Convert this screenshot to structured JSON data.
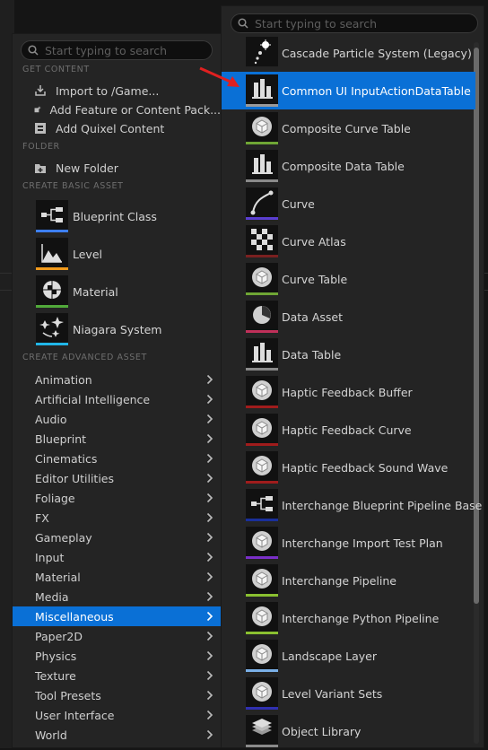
{
  "left_menu": {
    "search_placeholder": "Start typing to search",
    "sections": {
      "get_content": "GET CONTENT",
      "folder": "FOLDER",
      "basic": "CREATE BASIC ASSET",
      "advanced": "CREATE ADVANCED ASSET"
    },
    "get_content_items": [
      {
        "label": "Import to /Game...",
        "icon": "import-icon"
      },
      {
        "label": "Add Feature or Content Pack...",
        "icon": "content-pack-icon"
      },
      {
        "label": "Add Quixel Content",
        "icon": "quixel-icon"
      }
    ],
    "folder_items": [
      {
        "label": "New Folder",
        "icon": "new-folder-icon"
      }
    ],
    "basic_assets": [
      {
        "label": "Blueprint Class",
        "icon": "blueprint-class-icon",
        "color": "#3d7ff2"
      },
      {
        "label": "Level",
        "icon": "level-icon",
        "color": "#f19a1c"
      },
      {
        "label": "Material",
        "icon": "material-icon",
        "color": "#51a93a"
      },
      {
        "label": "Niagara System",
        "icon": "niagara-system-icon",
        "color": "#21b6e8"
      }
    ],
    "categories": [
      {
        "label": "Animation"
      },
      {
        "label": "Artificial Intelligence"
      },
      {
        "label": "Audio"
      },
      {
        "label": "Blueprint"
      },
      {
        "label": "Cinematics"
      },
      {
        "label": "Editor Utilities"
      },
      {
        "label": "Foliage"
      },
      {
        "label": "FX"
      },
      {
        "label": "Gameplay"
      },
      {
        "label": "Input"
      },
      {
        "label": "Material"
      },
      {
        "label": "Media"
      },
      {
        "label": "Miscellaneous",
        "selected": true
      },
      {
        "label": "Paper2D"
      },
      {
        "label": "Physics"
      },
      {
        "label": "Texture"
      },
      {
        "label": "Tool Presets"
      },
      {
        "label": "User Interface"
      },
      {
        "label": "World"
      }
    ]
  },
  "right_menu": {
    "search_placeholder": "Start typing to search",
    "items": [
      {
        "label": "Cascade Particle System (Legacy)",
        "icon": "particle-icon",
        "color": "#242424"
      },
      {
        "label": "Common UI InputActionDataTable",
        "icon": "data-table-icon",
        "color": "#9a9a9a",
        "selected": true
      },
      {
        "label": "Composite Curve Table",
        "icon": "cube-icon",
        "color": "#6fa635"
      },
      {
        "label": "Composite Data Table",
        "icon": "data-table-icon",
        "color": "#8a8a8a"
      },
      {
        "label": "Curve",
        "icon": "curve-icon",
        "color": "#5a3ed0"
      },
      {
        "label": "Curve Atlas",
        "icon": "checker-icon",
        "color": "#7a2020"
      },
      {
        "label": "Curve Table",
        "icon": "cube-icon",
        "color": "#6fa635"
      },
      {
        "label": "Data Asset",
        "icon": "pie-icon",
        "color": "#c0305a"
      },
      {
        "label": "Data Table",
        "icon": "data-table-icon",
        "color": "#8a8a8a"
      },
      {
        "label": "Haptic Feedback Buffer",
        "icon": "cube-icon",
        "color": "#a01c1c"
      },
      {
        "label": "Haptic Feedback Curve",
        "icon": "cube-icon",
        "color": "#a01c1c"
      },
      {
        "label": "Haptic Feedback Sound Wave",
        "icon": "cube-icon",
        "color": "#a01c1c"
      },
      {
        "label": "Interchange Blueprint Pipeline Base",
        "icon": "blueprint-class-icon",
        "color": "#1a2f9a"
      },
      {
        "label": "Interchange Import Test Plan",
        "icon": "cube-icon",
        "color": "#7a2fc8"
      },
      {
        "label": "Interchange Pipeline",
        "icon": "cube-icon",
        "color": "#8ac030"
      },
      {
        "label": "Interchange Python Pipeline",
        "icon": "cube-icon",
        "color": "#8ac030"
      },
      {
        "label": "Landscape Layer",
        "icon": "cube-icon",
        "color": "#7ab0e8"
      },
      {
        "label": "Level Variant Sets",
        "icon": "cube-icon",
        "color": "#3030b0"
      },
      {
        "label": "Object Library",
        "icon": "layers-icon",
        "color": "#8a8a8a"
      }
    ]
  },
  "colors": {
    "accent": "#0a70d6",
    "arrow": "#e02020"
  }
}
